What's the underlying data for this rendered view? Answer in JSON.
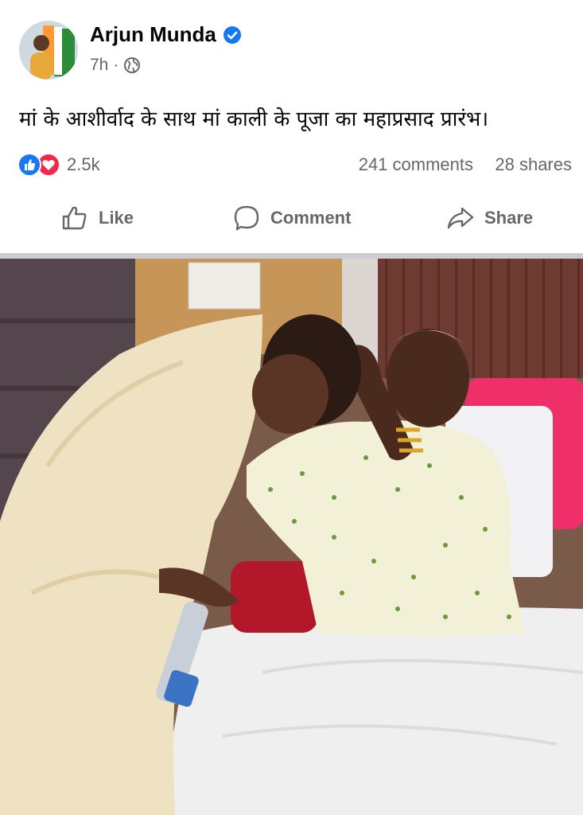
{
  "post": {
    "author": "Arjun Munda",
    "time": "7h",
    "separator": "·",
    "text": "मां के आशीर्वाद के साथ मां काली के पूजा का महाप्रसाद प्रारंभ।"
  },
  "stats": {
    "reaction_count": "2.5k",
    "comments": "241 comments",
    "shares": "28 shares"
  },
  "actions": {
    "like": "Like",
    "comment": "Comment",
    "share": "Share"
  },
  "icons": {
    "verified": "verified-badge-icon",
    "audience": "globe-icon",
    "like_reaction": "like-reaction-icon",
    "love_reaction": "love-reaction-icon",
    "like": "thumbs-up-icon",
    "comment": "comment-bubble-icon",
    "share": "share-arrow-icon"
  },
  "colors": {
    "brand_blue": "#1877f2",
    "love_red": "#f02849",
    "secondary_text": "#65676b"
  }
}
